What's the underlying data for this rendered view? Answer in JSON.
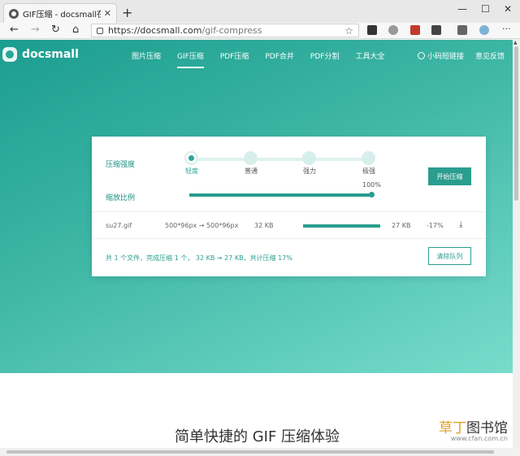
{
  "browser": {
    "tab_title": "GIF压缩 - docsmall在线GIF压缩",
    "tab_close": "✕",
    "new_tab": "+",
    "url_host": "https://docsmall.com",
    "url_path": "/gif-compress",
    "win_min": "—",
    "win_max": "☐",
    "win_close": "✕"
  },
  "header": {
    "logo_text": "docsmall",
    "nav": [
      "图片压缩",
      "GIF压缩",
      "PDF压缩",
      "PDF合并",
      "PDF分割",
      "工具大全"
    ],
    "active_index": 1,
    "mini_program": "小码短链接",
    "feedback": "意见反馈"
  },
  "card": {
    "strength_label": "压缩强度",
    "strength_steps": [
      "轻度",
      "普通",
      "强力",
      "极强"
    ],
    "strength_selected": 0,
    "scale_label": "缩放比例",
    "scale_percent_text": "100%",
    "scale_value": 1.0,
    "start_button": "开始压缩",
    "file": {
      "name": "su27.gif",
      "dims": "500*96px → 500*96px",
      "size_before": "32 KB",
      "size_after": "27 KB",
      "ratio": "-17%",
      "progress": 1.0
    },
    "summary": "共 1 个文件，完成压缩 1 个，  32 KB → 27 KB，共计压缩 17%",
    "clear_button": "清除队列"
  },
  "section_title": "简单快捷的 GIF 压缩体验",
  "watermark": {
    "part1": "草丁",
    "part2": "图书馆",
    "sub": "www.cfan.com.cn"
  },
  "colors": {
    "brand": "#2a9d8f",
    "hero_start": "#1b9d8f",
    "hero_end": "#78dccb"
  }
}
